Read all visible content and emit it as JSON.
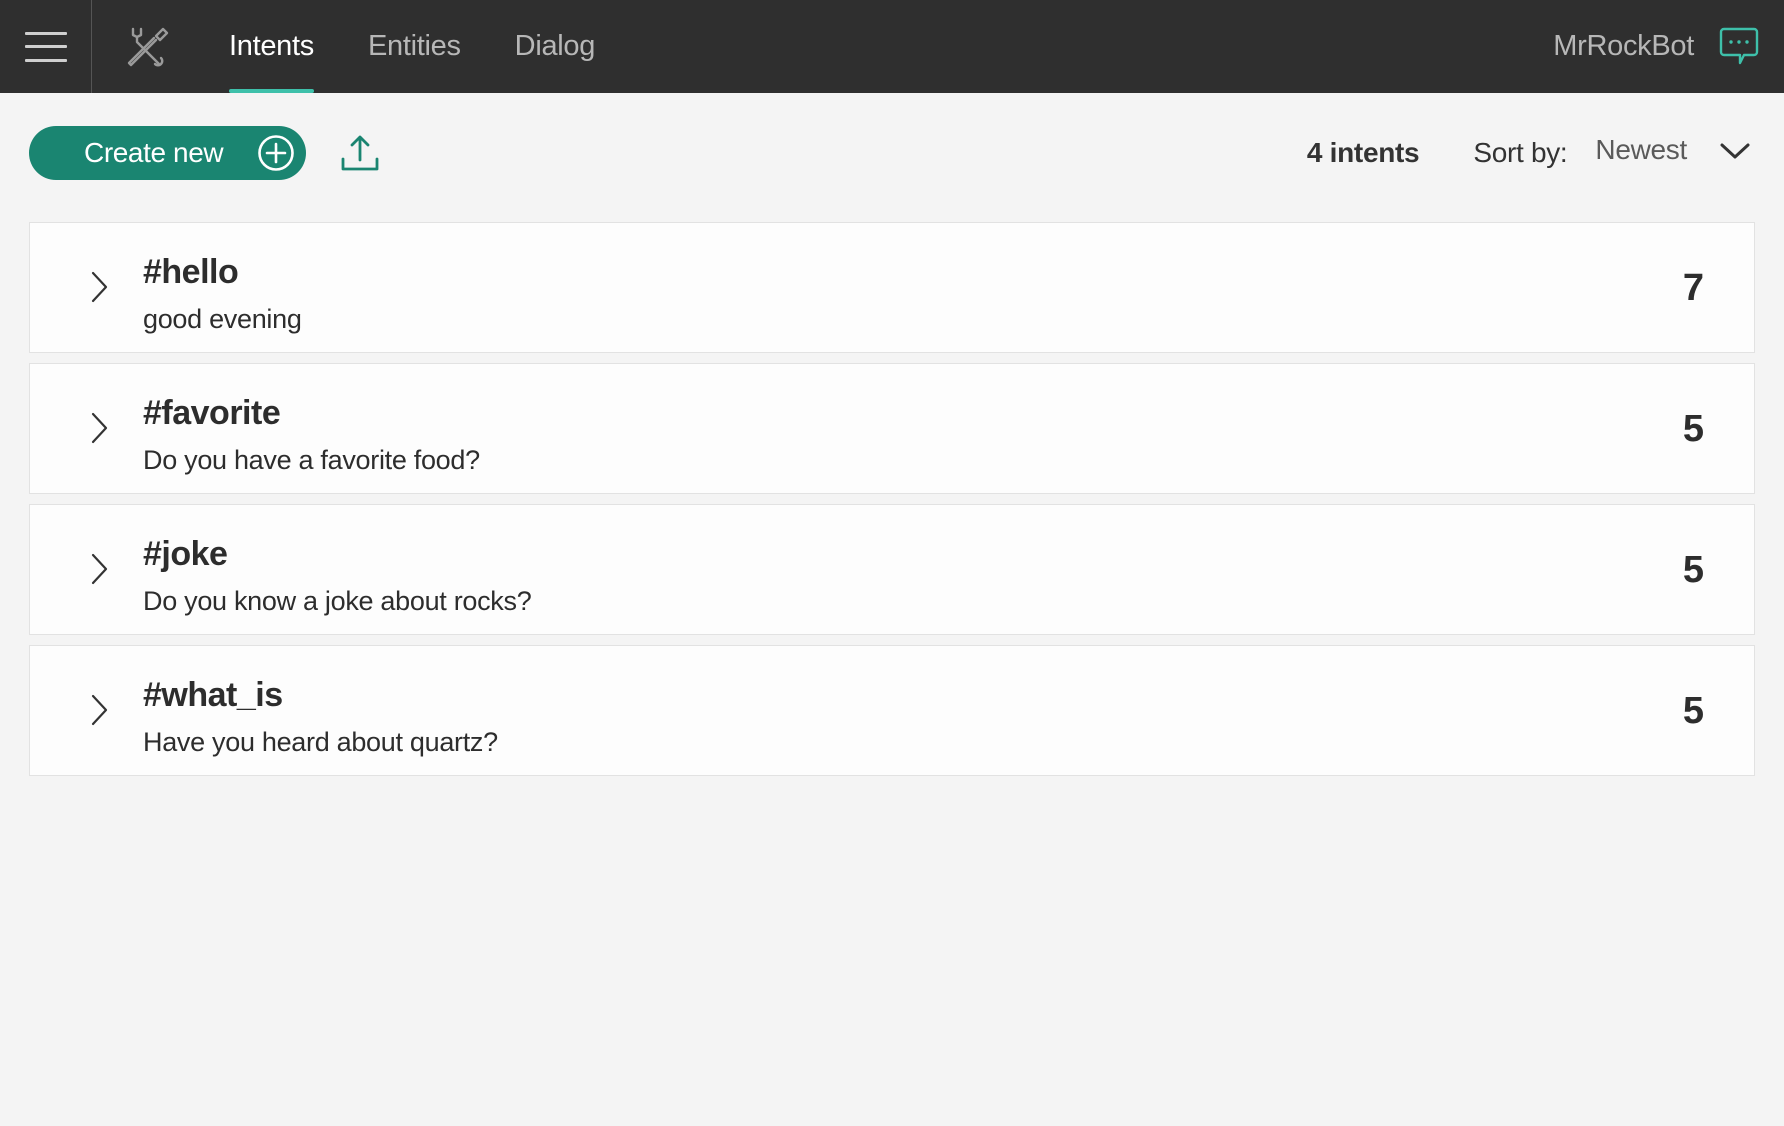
{
  "header": {
    "menu_icon": "hamburger-menu-icon",
    "tools_icon": "tools-icon",
    "tabs": [
      {
        "label": "Intents",
        "active": true
      },
      {
        "label": "Entities",
        "active": false
      },
      {
        "label": "Dialog",
        "active": false
      }
    ],
    "bot_name": "MrRockBot",
    "chat_icon": "chat-bubble-icon"
  },
  "toolbar": {
    "create_label": "Create new",
    "count_label": "4 intents",
    "sort_label": "Sort by:",
    "sort_value": "Newest"
  },
  "intents": [
    {
      "name": "#hello",
      "example": "good evening",
      "count": "7"
    },
    {
      "name": "#favorite",
      "example": "Do you have a favorite food?",
      "count": "5"
    },
    {
      "name": "#joke",
      "example": "Do you know a joke about rocks?",
      "count": "5"
    },
    {
      "name": "#what_is",
      "example": "Have you heard about quartz?",
      "count": "5"
    }
  ],
  "colors": {
    "topbar": "#2f2f2f",
    "accent": "#3ec0aa",
    "primary_button": "#1a8571",
    "background": "#f4f4f4"
  }
}
